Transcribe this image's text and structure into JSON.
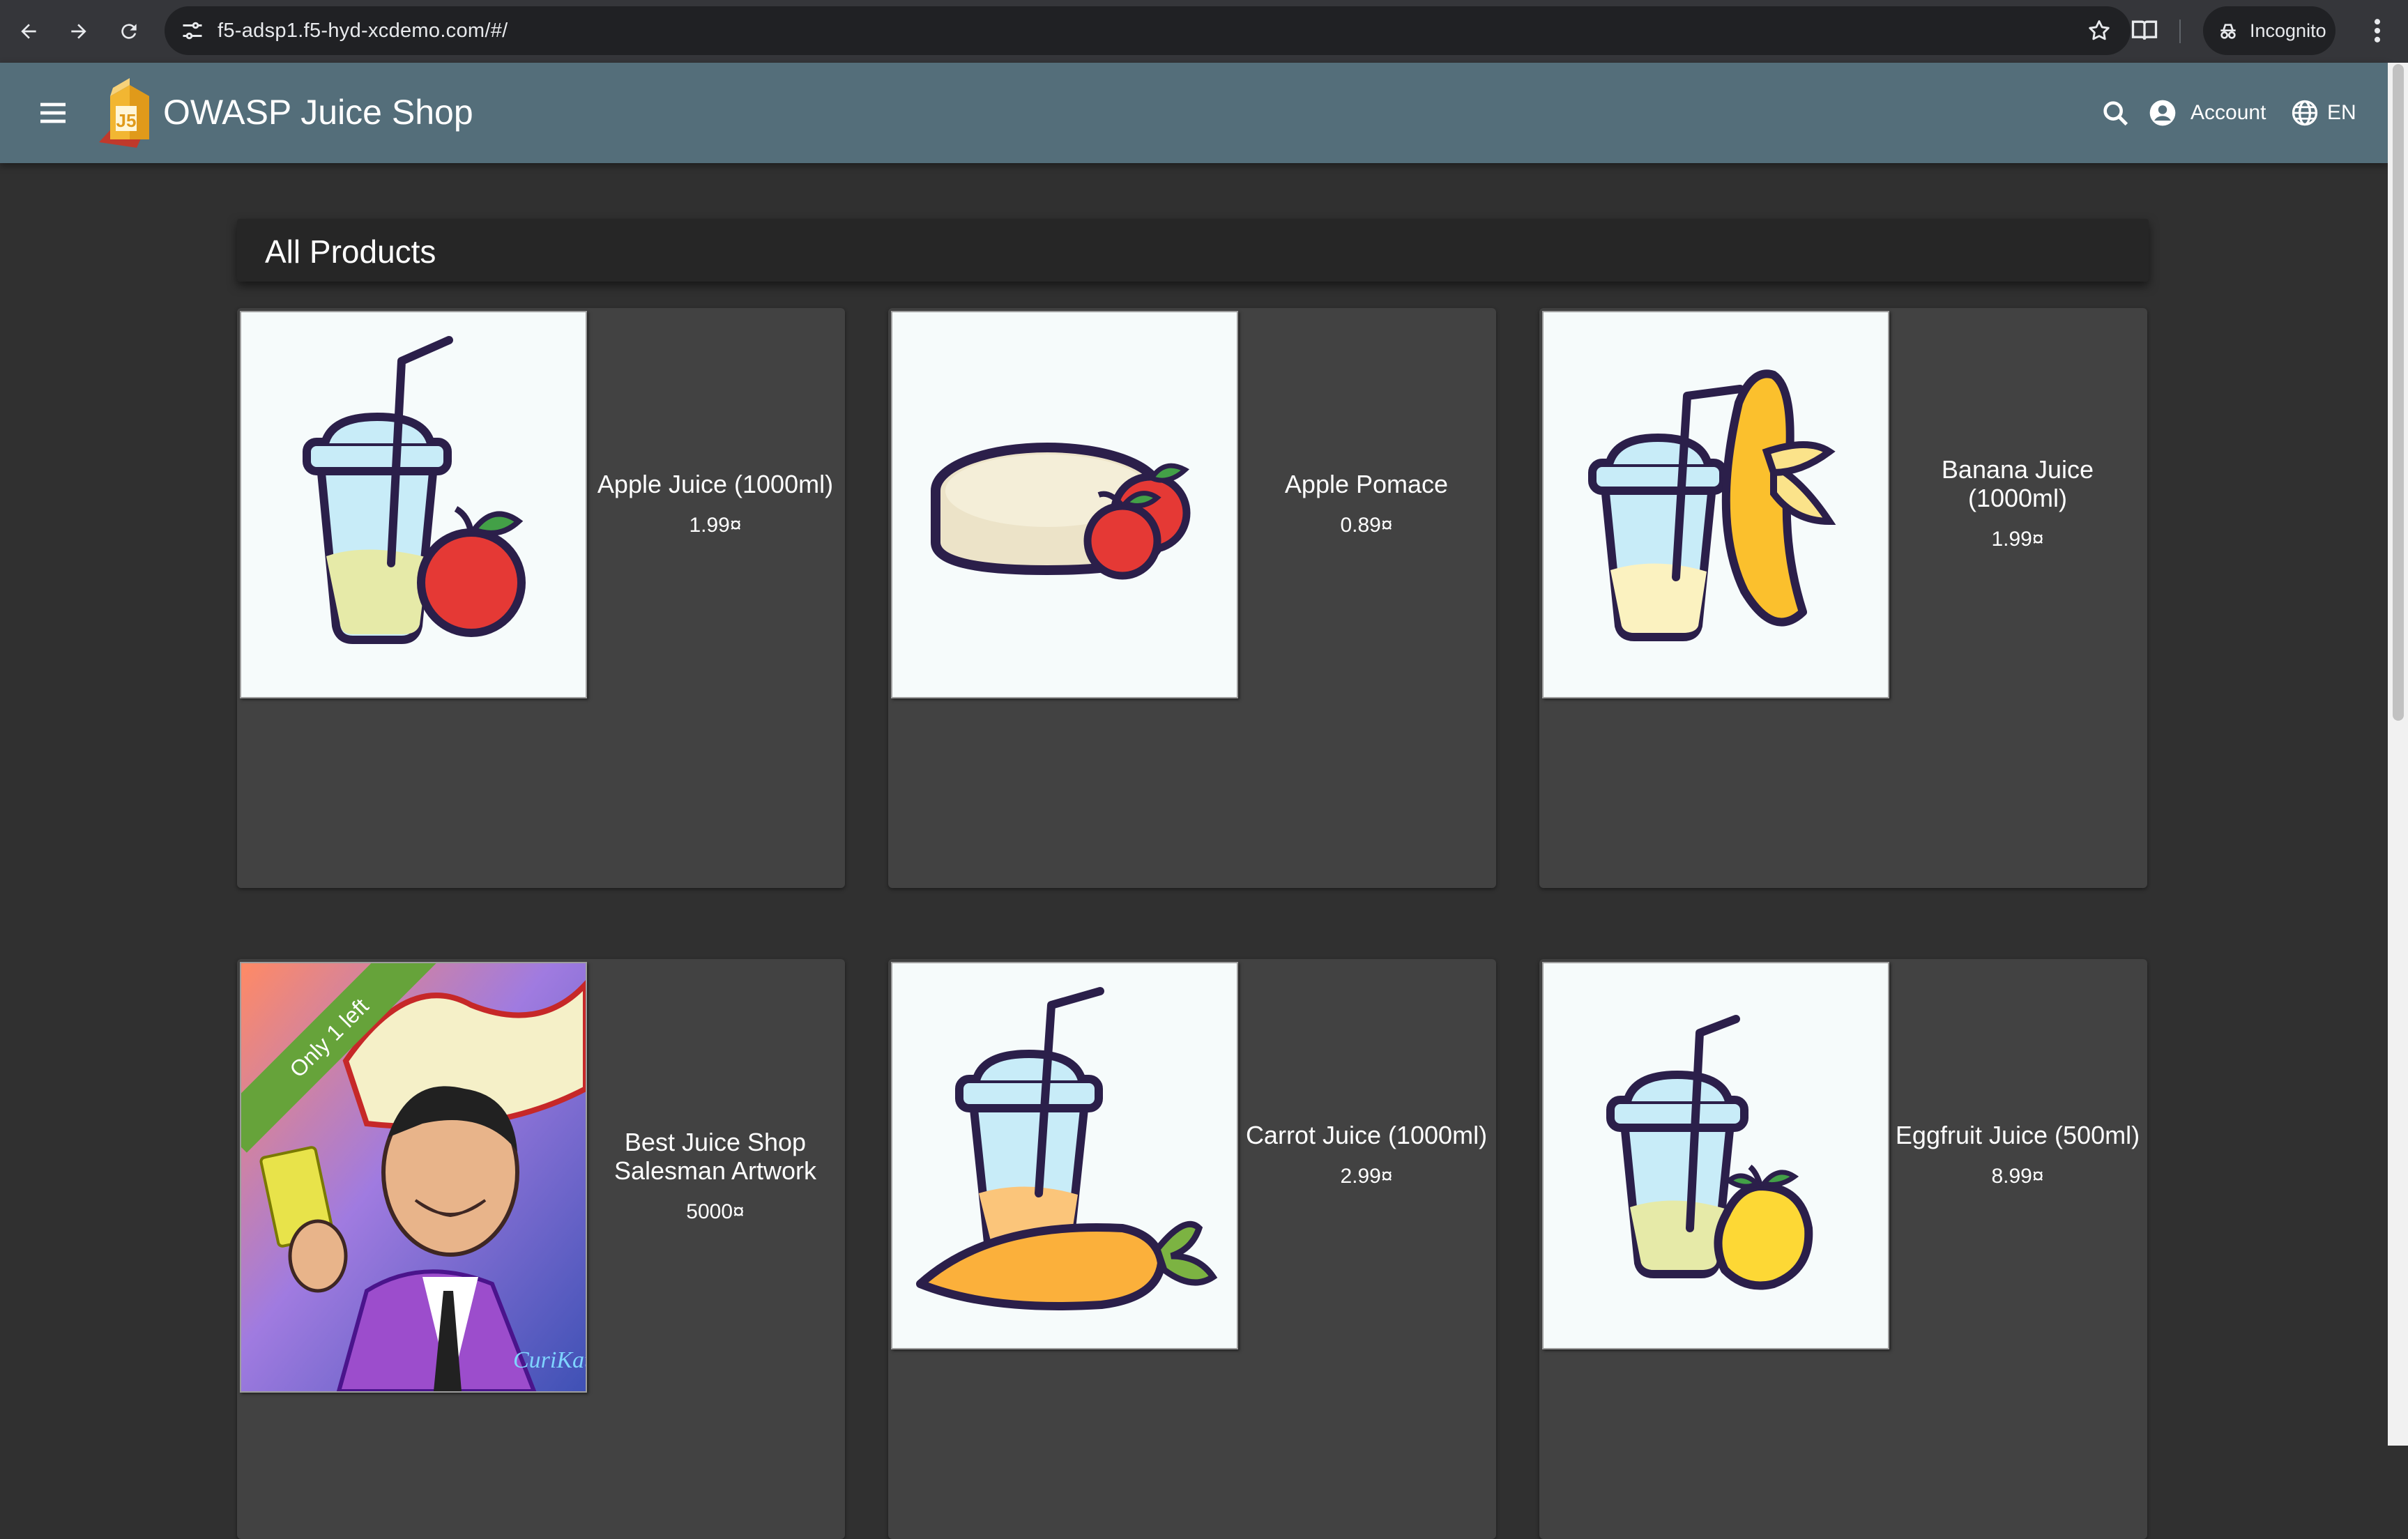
{
  "browser": {
    "url": "f5-adsp1.f5-hyd-xcdemo.com/#/",
    "incognito_label": "Incognito"
  },
  "toolbar": {
    "title": "OWASP Juice Shop",
    "account_label": "Account",
    "language_label": "EN"
  },
  "main": {
    "heading": "All Products",
    "products": [
      {
        "name": "Apple Juice (1000ml)",
        "price": "1.99¤",
        "icon": "apple-juice-image"
      },
      {
        "name": "Apple Pomace",
        "price": "0.89¤",
        "icon": "apple-pomace-image"
      },
      {
        "name": "Banana Juice (1000ml)",
        "price": "1.99¤",
        "icon": "banana-juice-image"
      },
      {
        "name": "Best Juice Shop Salesman Artwork",
        "price": "5000¤",
        "icon": "salesman-artwork-image",
        "badge": "Only 1 left"
      },
      {
        "name": "Carrot Juice (1000ml)",
        "price": "2.99¤",
        "icon": "carrot-juice-image"
      },
      {
        "name": "Eggfruit Juice (500ml)",
        "price": "8.99¤",
        "icon": "eggfruit-juice-image"
      }
    ]
  },
  "colors": {
    "toolbar": "#546e7a",
    "background": "#303030",
    "card": "#424242",
    "badge": "#66a33a"
  }
}
